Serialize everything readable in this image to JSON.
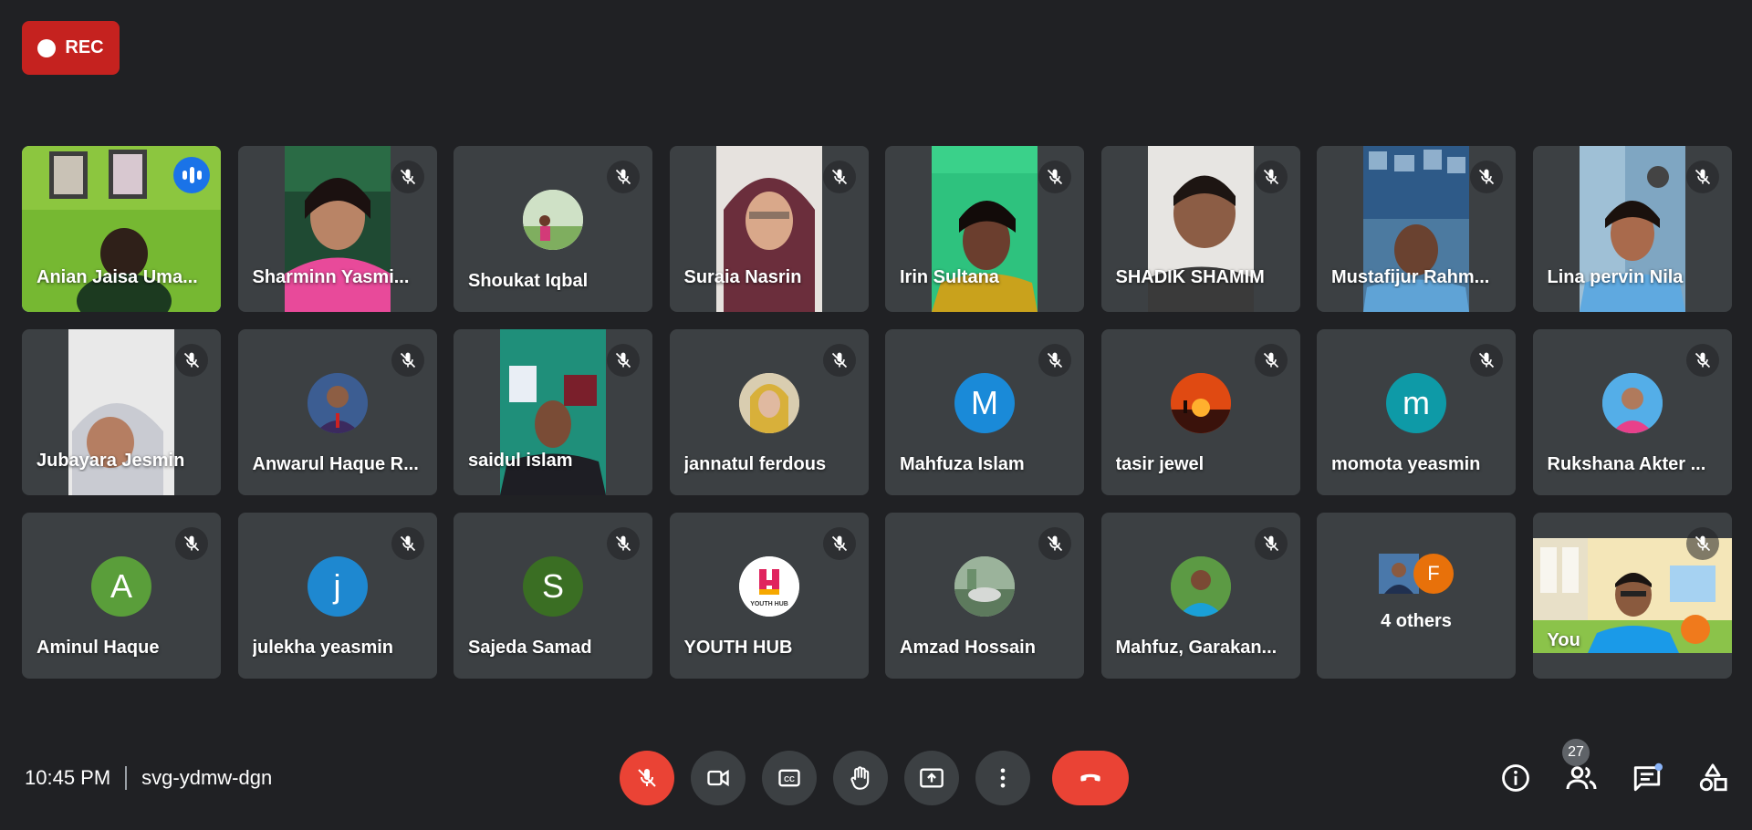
{
  "recording": {
    "label": "REC"
  },
  "participants": [
    {
      "name": "Anian Jaisa Uma...",
      "type": "video",
      "speaking": true
    },
    {
      "name": "Sharminn Yasmi...",
      "type": "video"
    },
    {
      "name": "Shoukat Iqbal",
      "type": "photo"
    },
    {
      "name": "Suraia Nasrin",
      "type": "video"
    },
    {
      "name": "Irin Sultana",
      "type": "video"
    },
    {
      "name": "SHADIK SHAMIM",
      "type": "video"
    },
    {
      "name": "Mustafijur Rahm...",
      "type": "video"
    },
    {
      "name": "Lina pervin Nila",
      "type": "video"
    },
    {
      "name": "Jubayara Jesmin",
      "type": "video"
    },
    {
      "name": "Anwarul Haque R...",
      "type": "photo"
    },
    {
      "name": "saidul islam",
      "type": "video"
    },
    {
      "name": "jannatul ferdous",
      "type": "photo"
    },
    {
      "name": "Mahfuza Islam",
      "type": "letter",
      "letter": "M",
      "color": "#1a8ad8"
    },
    {
      "name": "tasir jewel",
      "type": "photo"
    },
    {
      "name": "momota yeasmin",
      "type": "letter",
      "letter": "m",
      "color": "#0e9aa7"
    },
    {
      "name": "Rukshana Akter ...",
      "type": "photo"
    },
    {
      "name": "Aminul Haque",
      "type": "letter",
      "letter": "A",
      "color": "#5a9e3a"
    },
    {
      "name": "julekha yeasmin",
      "type": "letter",
      "letter": "j",
      "color": "#1e88d0"
    },
    {
      "name": "Sajeda Samad",
      "type": "letter",
      "letter": "S",
      "color": "#3a6e23"
    },
    {
      "name": "YOUTH HUB",
      "type": "logo"
    },
    {
      "name": "Amzad Hossain",
      "type": "photo"
    },
    {
      "name": "Mahfuz, Garakan...",
      "type": "photo"
    },
    {
      "name": "4 others",
      "type": "others",
      "letter": "F",
      "color": "#e8710a"
    },
    {
      "name": "You",
      "type": "self"
    }
  ],
  "footer": {
    "time": "10:45 PM",
    "meeting_code": "svg-ydmw-dgn",
    "people_count": "27"
  },
  "controls": [
    {
      "name": "microphone-off-button",
      "icon": "mic-off-icon",
      "active": true
    },
    {
      "name": "camera-button",
      "icon": "videocam-icon"
    },
    {
      "name": "captions-button",
      "icon": "cc-icon"
    },
    {
      "name": "raise-hand-button",
      "icon": "hand-icon"
    },
    {
      "name": "present-button",
      "icon": "present-icon"
    },
    {
      "name": "more-options-button",
      "icon": "more-vert-icon"
    },
    {
      "name": "leave-call-button",
      "icon": "call-end-icon"
    }
  ],
  "colors": {
    "background": "#202124",
    "tile": "#3c4043",
    "accent_blue": "#1a73e8",
    "danger_red": "#ea4335",
    "rec_red": "#c5221f"
  }
}
